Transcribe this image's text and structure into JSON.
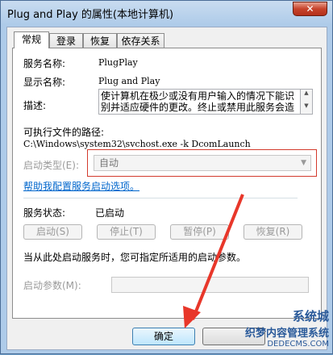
{
  "window": {
    "title": "Plug and Play 的属性(本地计算机)",
    "close_glyph": "✕"
  },
  "tabs": [
    {
      "label": "常规"
    },
    {
      "label": "登录"
    },
    {
      "label": "恢复"
    },
    {
      "label": "依存关系"
    }
  ],
  "general": {
    "service_name_label": "服务名称:",
    "service_name_value": "PlugPlay",
    "display_name_label": "显示名称:",
    "display_name_value": "Plug and Play",
    "description_label": "描述:",
    "description_value": "使计算机在极少或没有用户输入的情况下能识别并适应硬件的更改。终止或禁用此服务会造",
    "exe_path_label": "可执行文件的路径:",
    "exe_path_value": "C:\\Windows\\system32\\svchost.exe -k DcomLaunch",
    "startup_type_label": "启动类型(E):",
    "startup_type_value": "自动",
    "help_link": "帮助我配置服务启动选项。",
    "status_label": "服务状态:",
    "status_value": "已启动",
    "buttons": {
      "start": "启动(S)",
      "stop": "停止(T)",
      "pause": "暂停(P)",
      "resume": "恢复(R)"
    },
    "hint": "当从此处启动服务时，您可指定所适用的启动参数。",
    "start_params_label": "启动参数(M):"
  },
  "footer": {
    "ok": "确定"
  },
  "watermark": {
    "line1": "系统城",
    "line2": "织梦内容管理系统",
    "line3": "DEDECMS.COM"
  },
  "colors": {
    "highlight_box": "#d33a2c",
    "arrow": "#e8372a",
    "link": "#0066cc"
  }
}
